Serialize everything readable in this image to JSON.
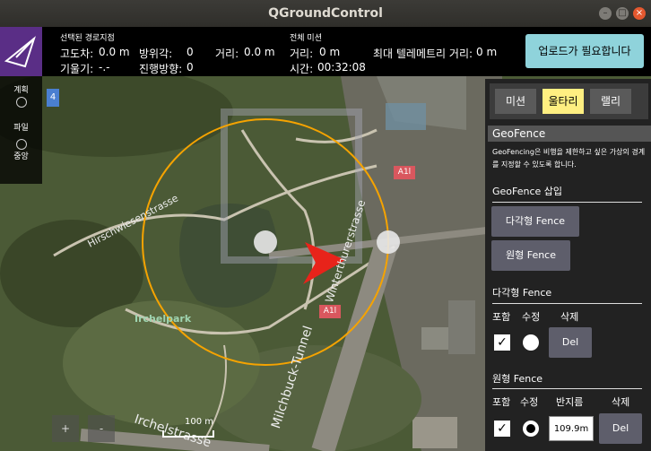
{
  "window": {
    "title": "QGroundControl"
  },
  "toolbar": {
    "selected_waypoint_label": "선택된 경로지점",
    "altitude_diff_label": "고도차:",
    "altitude_diff_value": "0.0 m",
    "azimuth_label": "방위각:",
    "azimuth_value": "0",
    "distance_label": "거리:",
    "distance_value": "0.0 m",
    "gradient_label": "기울기:",
    "gradient_value": "-.-",
    "heading_label": "진행방향:",
    "heading_value": "0",
    "total_mission_label": "전체 미션",
    "total_distance_label": "거리:",
    "total_distance_value": "0 m",
    "max_telemetry_label": "최대 텔레메트리 거리:",
    "max_telemetry_value": "0 m",
    "time_label": "시간:",
    "time_value": "00:32:08",
    "upload_button": "업로드가 필요합니다"
  },
  "left_tools": [
    {
      "label": "계획",
      "icon": "plan-icon"
    },
    {
      "label": "파일",
      "icon": "file-icon"
    },
    {
      "label": "중앙",
      "icon": "center-icon"
    }
  ],
  "map": {
    "labels": {
      "street1": "Hirschwiesenstrasse",
      "park": "Irchelpark",
      "street2": "Winterthurerstrasse",
      "tunnel": "Milchbuck-Tunnel",
      "street3": "Irchelstrasse",
      "road_sign1": "A1l",
      "road_sign2": "A1l",
      "tab_marker": "4"
    },
    "scale_label": "100 m",
    "zoom_in": "+",
    "zoom_out": "-"
  },
  "panel": {
    "tabs": [
      "미션",
      "울타리",
      "랠리"
    ],
    "active_tab": 1,
    "geofence_title": "GeoFence",
    "geofence_desc": "GeoFencing은 비행을 제한하고 싶은 가상의 경계를 지정할 수 있도록 합니다.",
    "insert_section": "GeoFence 삽입",
    "polygon_fence_button": "다각형 Fence",
    "circle_fence_button": "원형 Fence",
    "polygon_section": "다각형 Fence",
    "polygon_headers": {
      "include": "포함",
      "edit": "수정",
      "delete": "삭제"
    },
    "polygon_del_button": "Del",
    "circle_section": "원형 Fence",
    "circle_headers": {
      "include": "포함",
      "edit": "수정",
      "radius": "반지름",
      "delete": "삭제"
    },
    "circle_radius_value": "109.9m",
    "circle_del_button": "Del"
  },
  "colors": {
    "toolbar_bg": "#000000",
    "logo_bg": "#5a2e86",
    "upload_button_bg": "#8fd3db",
    "active_tab_bg": "#ffef81",
    "fence_circle": "#f5a300",
    "vehicle_arrow": "#e8231a"
  }
}
